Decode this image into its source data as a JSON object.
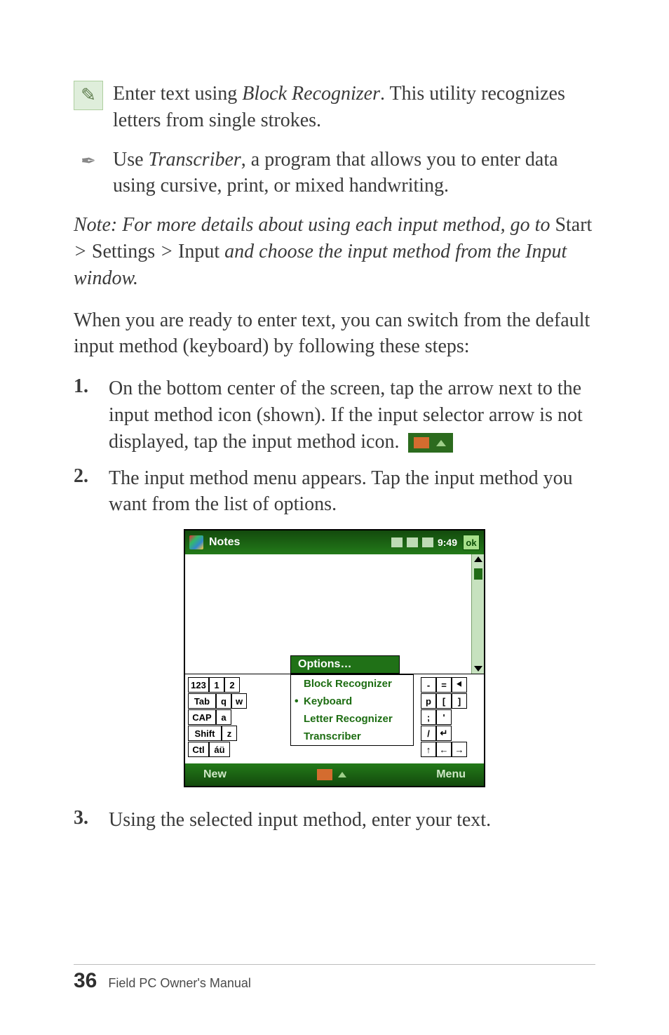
{
  "blocks": {
    "block_recognizer": {
      "pre": "Enter text using ",
      "em": "Block Recognizer",
      "post": ". This utility recognizes letters from single strokes.",
      "icon_name": "block-recognizer-icon"
    },
    "transcriber": {
      "pre": "Use ",
      "em": "Transcriber",
      "post": ", a program that allows you to enter data using cursive, print, or mixed handwriting.",
      "icon_name": "transcriber-icon"
    }
  },
  "note": {
    "lead": "Note: For more details about using each input method, go to ",
    "path1": "Start",
    "sep1": " > ",
    "path2": "Settings",
    "sep2": " > ",
    "path3": "Input",
    "tail": " and choose the input method from the Input window."
  },
  "intro": "When you are ready to enter text, you can switch from the default input method (keyboard) by following these steps:",
  "steps": [
    {
      "num": "1.",
      "text": "On the bottom center of the screen, tap the arrow next to the input method icon (shown). If the input selector arrow is not displayed, tap the input method icon."
    },
    {
      "num": "2.",
      "text": "The input method menu appears. Tap the input method you want from the list of options."
    },
    {
      "num": "3.",
      "text": "Using the selected input method, enter your text."
    }
  ],
  "screenshot": {
    "title": "Notes",
    "clock": "9:49",
    "ok": "ok",
    "options": "Options…",
    "menu": {
      "items": [
        "Block Recognizer",
        "Keyboard",
        "Letter Recognizer",
        "Transcriber"
      ],
      "selected_index": 1
    },
    "keyboard_left": [
      [
        "123",
        "1",
        "2"
      ],
      [
        "Tab",
        "q",
        "w"
      ],
      [
        "CAP",
        "a"
      ],
      [
        "Shift",
        "z"
      ],
      [
        "Ctl",
        "áü"
      ]
    ],
    "keyboard_right": [
      [
        "-",
        "=",
        "⯇"
      ],
      [
        "p",
        "[",
        "]"
      ],
      [
        ";",
        "'"
      ],
      [
        "/",
        "↵"
      ],
      [
        "↑",
        "←",
        "→"
      ]
    ],
    "bottom": {
      "left": "New",
      "right": "Menu"
    }
  },
  "footer": {
    "page": "36",
    "title": "Field PC Owner's Manual"
  }
}
